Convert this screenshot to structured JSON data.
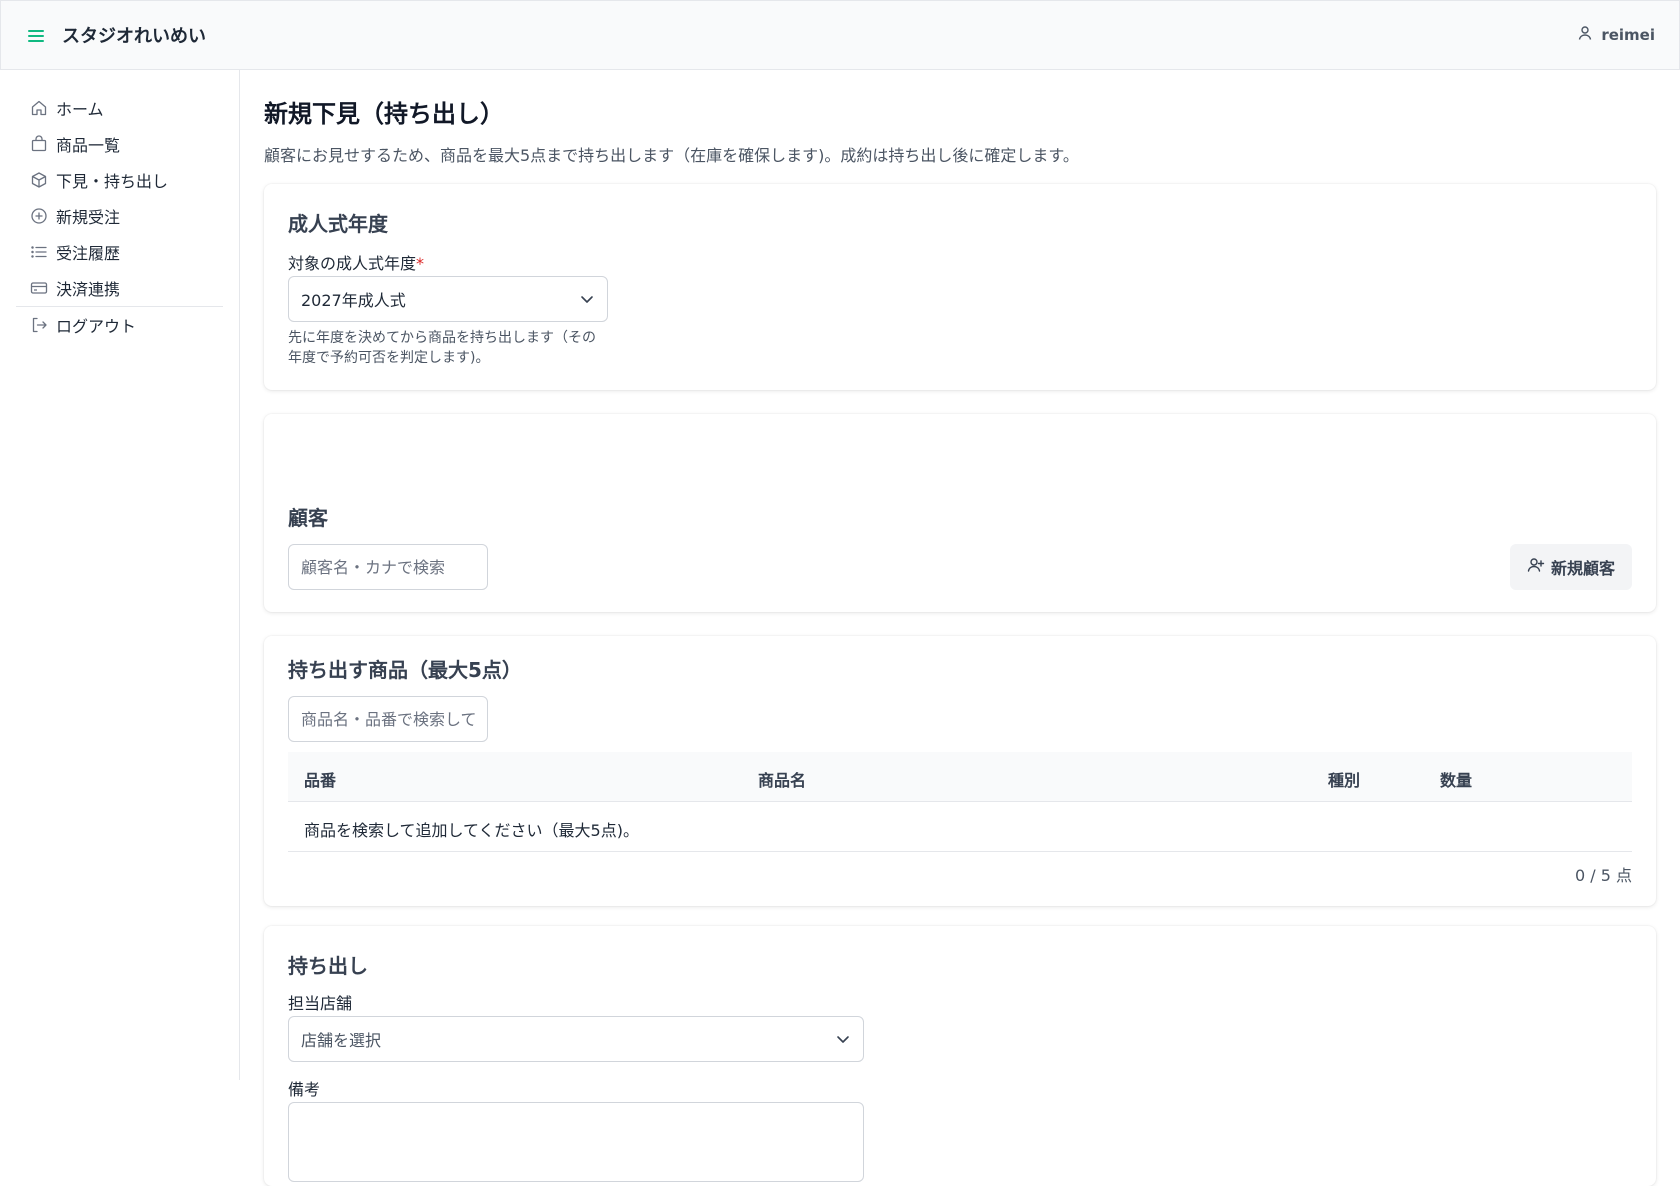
{
  "header": {
    "brand": "スタジオれいめい",
    "user_name": "reimei"
  },
  "sidebar": {
    "items": [
      {
        "label": "ホーム",
        "icon": "home-icon"
      },
      {
        "label": "商品一覧",
        "icon": "shopping-bag-icon"
      },
      {
        "label": "下見・持ち出し",
        "icon": "box-icon"
      },
      {
        "label": "新規受注",
        "icon": "plus-circle-icon"
      },
      {
        "label": "受注履歴",
        "icon": "list-icon"
      },
      {
        "label": "決済連携",
        "icon": "credit-card-icon"
      }
    ],
    "logout": {
      "label": "ログアウト",
      "icon": "logout-icon"
    }
  },
  "page": {
    "title": "新規下見（持ち出し）",
    "description": "顧客にお見せするため、商品を最大5点まで持ち出します（在庫を確保します)。成約は持ち出し後に確定します。"
  },
  "year_section": {
    "title": "成人式年度",
    "label": "対象の成人式年度",
    "required_mark": "*",
    "selected": "2027年成人式",
    "help": "先に年度を決めてから商品を持ち出します（その年度で予約可否を判定します)。"
  },
  "customer_section": {
    "title": "顧客",
    "search_placeholder": "顧客名・カナで検索",
    "new_customer_label": "新規顧客"
  },
  "items_section": {
    "title": "持ち出す商品（最大5点）",
    "search_placeholder": "商品名・品番で検索して",
    "columns": [
      "品番",
      "商品名",
      "種別",
      "数量"
    ],
    "empty_message": "商品を検索して追加してください（最大5点)。",
    "count_text": "0 / 5 点"
  },
  "checkout_section": {
    "title": "持ち出し",
    "store_label": "担当店舗",
    "store_placeholder": "店舗を選択",
    "notes_label": "備考"
  },
  "colors": {
    "accent": "#10b981",
    "required": "#dc2626",
    "header_bg": "#f9fafb",
    "border": "#e5e7eb"
  }
}
